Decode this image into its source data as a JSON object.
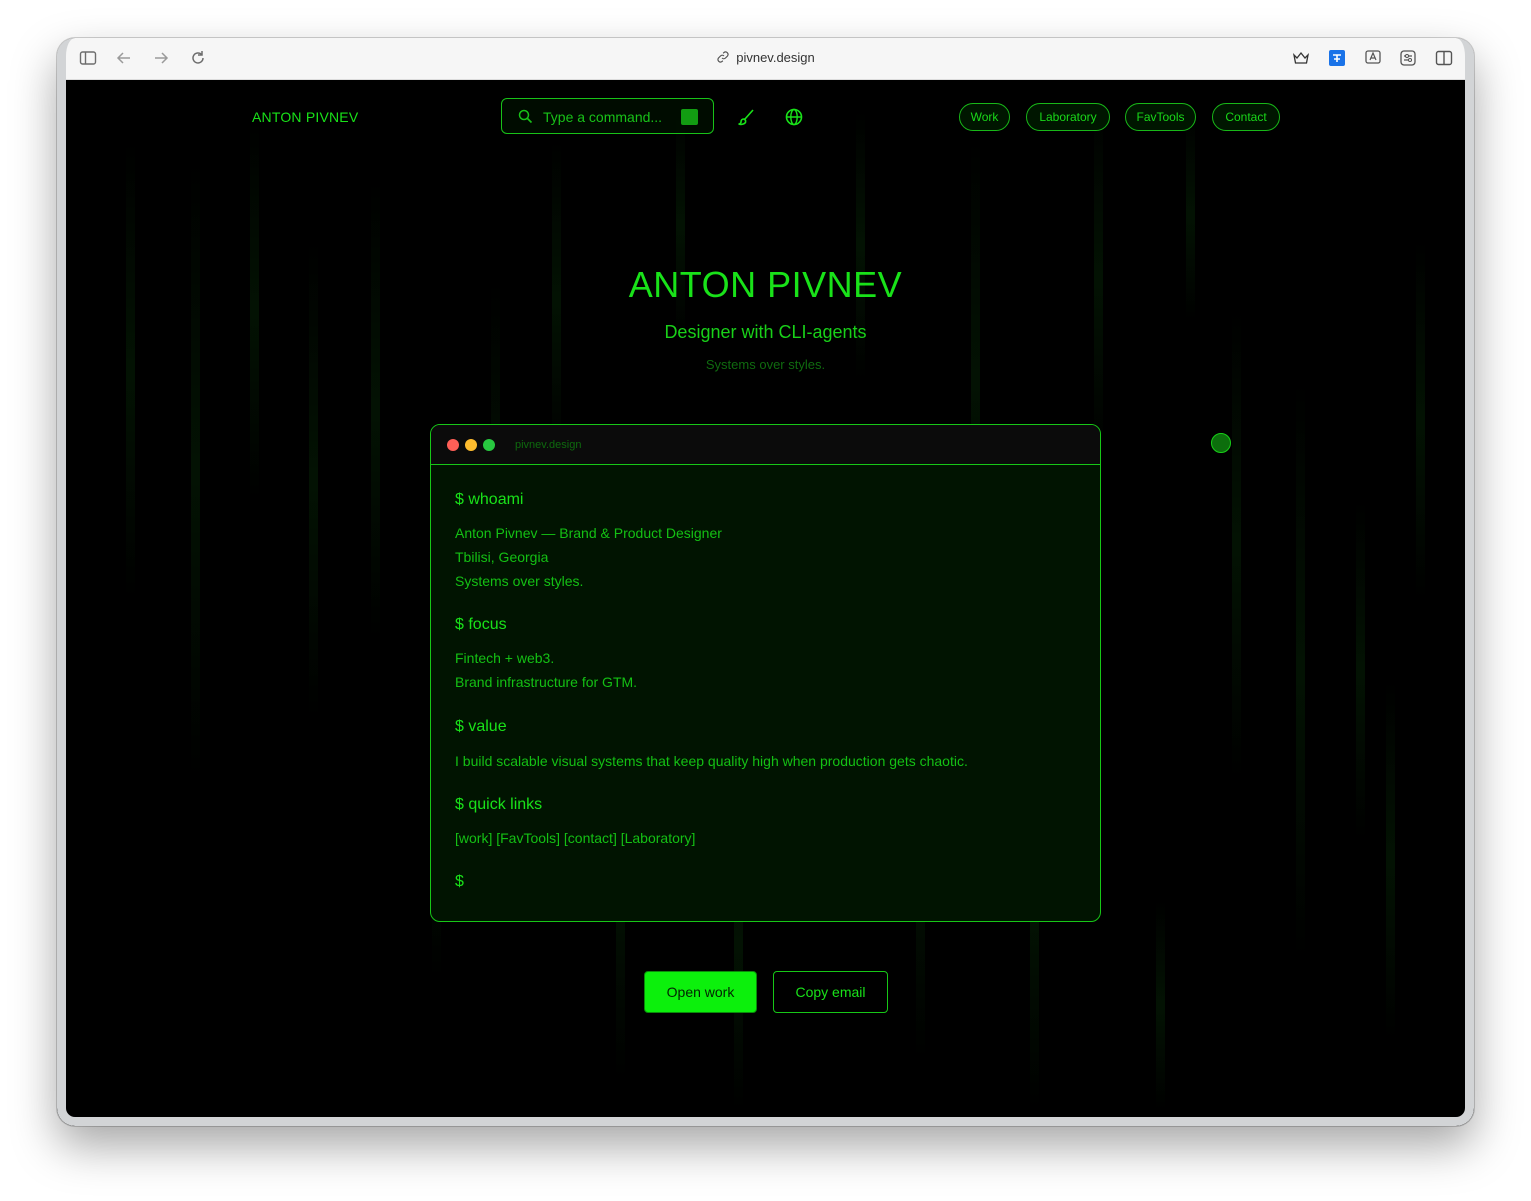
{
  "browser": {
    "url": "pivnev.design"
  },
  "header": {
    "brand": "ANTON PIVNEV",
    "command_placeholder": "Type a command...",
    "nav": [
      "Work",
      "Laboratory",
      "FavTools",
      "Contact"
    ]
  },
  "hero": {
    "title": "ANTON PIVNEV",
    "subtitle": "Designer with CLI-agents",
    "tagline": "Systems over styles."
  },
  "terminal": {
    "title": "pivnev.design",
    "sections": [
      {
        "command": "$  whoami",
        "lines": [
          "Anton Pivnev — Brand & Product Designer",
          "Tbilisi, Georgia",
          "Systems over styles."
        ]
      },
      {
        "command": "$  focus",
        "lines": [
          "Fintech + web3.",
          "Brand infrastructure for GTM."
        ]
      },
      {
        "command": "$  value",
        "lines": [
          "I build scalable visual systems that keep quality high when production gets chaotic."
        ]
      },
      {
        "command": "$  quick links",
        "lines": [
          "[work] [FavTools] [contact] [Laboratory]"
        ]
      }
    ],
    "prompt": "$"
  },
  "actions": {
    "primary": "Open work",
    "secondary": "Copy email"
  },
  "colors": {
    "accent": "#19e219",
    "background": "#000000",
    "terminal_bg": "#011401",
    "dot_red": "#ff5f57",
    "dot_yellow": "#febc2e",
    "dot_green": "#28c840"
  }
}
